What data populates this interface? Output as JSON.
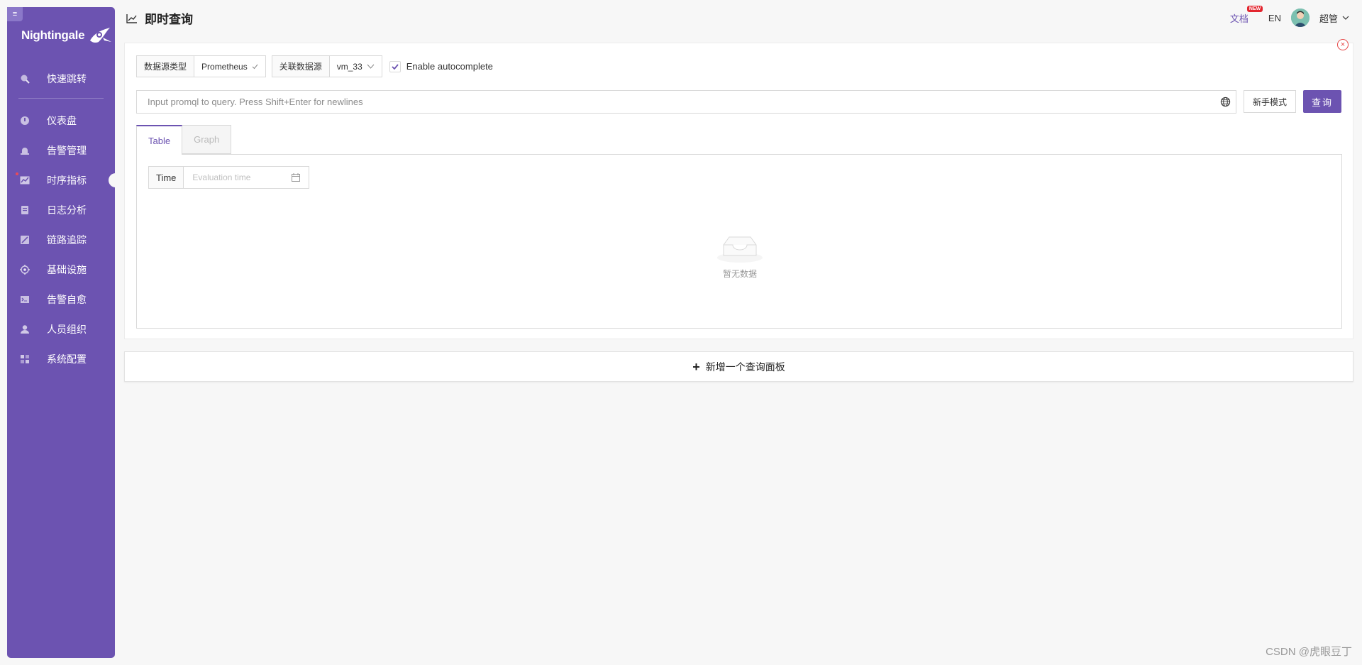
{
  "sidebar": {
    "brand": "Nightingale",
    "items": [
      {
        "label": "快速跳转",
        "icon": "search-icon"
      },
      {
        "label": "仪表盘",
        "icon": "dashboard-icon"
      },
      {
        "label": "告警管理",
        "icon": "alarm-icon"
      },
      {
        "label": "时序指标",
        "icon": "chart-icon",
        "active": true
      },
      {
        "label": "日志分析",
        "icon": "document-icon"
      },
      {
        "label": "链路追踪",
        "icon": "trace-icon"
      },
      {
        "label": "基础设施",
        "icon": "target-icon"
      },
      {
        "label": "告警自愈",
        "icon": "terminal-icon"
      },
      {
        "label": "人员组织",
        "icon": "user-icon"
      },
      {
        "label": "系统配置",
        "icon": "grid-icon"
      }
    ]
  },
  "header": {
    "title": "即时查询",
    "docs": "文档",
    "docs_badge": "NEW",
    "lang": "EN",
    "user": "超管"
  },
  "query": {
    "datasource_type_label": "数据源类型",
    "datasource_type_value": "Prometheus",
    "linked_datasource_label": "关联数据源",
    "linked_datasource_value": "vm_33",
    "autocomplete_label": "Enable autocomplete",
    "autocomplete_checked": true,
    "input_placeholder": "Input promql to query. Press Shift+Enter for newlines",
    "novice_button": "新手模式",
    "query_button": "查询",
    "tabs": [
      {
        "label": "Table",
        "active": true
      },
      {
        "label": "Graph",
        "active": false
      }
    ],
    "time_label": "Time",
    "time_placeholder": "Evaluation time",
    "empty_text": "暂无数据"
  },
  "add_panel": {
    "label": "新增一个查询面板"
  },
  "watermark": "CSDN @虎眼豆丁",
  "colors": {
    "brand": "#6c53b1",
    "danger": "#e64545"
  }
}
